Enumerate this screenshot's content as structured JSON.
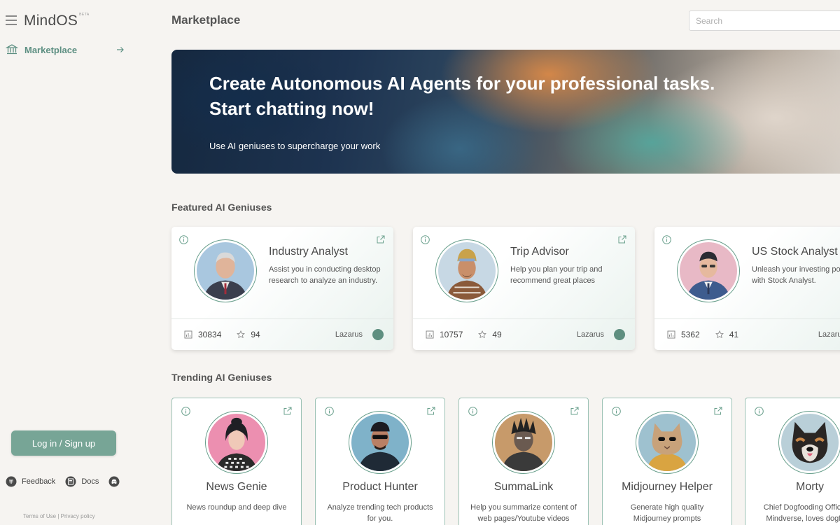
{
  "brand": {
    "name": "MindOS",
    "badge": "BETA"
  },
  "sidebar": {
    "items": [
      {
        "label": "Marketplace",
        "icon": "bank-icon"
      }
    ],
    "login_label": "Log in / Sign up",
    "footer": [
      {
        "label": "Feedback",
        "icon": "feedback-icon"
      },
      {
        "label": "Docs",
        "icon": "docs-icon"
      },
      {
        "label": "",
        "icon": "discord-icon"
      }
    ],
    "legal": {
      "terms": "Terms of Use",
      "separator": "|",
      "privacy": "Privacy policy"
    }
  },
  "header": {
    "title": "Marketplace",
    "search_placeholder": "Search"
  },
  "hero": {
    "title_line1": "Create Autonomous AI Agents for your professional tasks.",
    "title_line2": "Start chatting now!",
    "subtitle": "Use AI geniuses to supercharge your work"
  },
  "featured": {
    "title": "Featured AI Geniuses",
    "items": [
      {
        "name": "Industry Analyst",
        "desc": "Assist you in conducting desktop research to analyze an industry.",
        "uses": "30834",
        "stars": "94",
        "author": "Lazarus"
      },
      {
        "name": "Trip Advisor",
        "desc": "Help you plan your trip and recommend great places",
        "uses": "10757",
        "stars": "49",
        "author": "Lazarus"
      },
      {
        "name": "US Stock Analyst",
        "desc": "Unleash your investing potential with Stock Analyst.",
        "uses": "5362",
        "stars": "41",
        "author": "Lazarus"
      }
    ]
  },
  "trending": {
    "title": "Trending AI Geniuses",
    "items": [
      {
        "name": "News Genie",
        "desc": "News roundup and deep dive"
      },
      {
        "name": "Product Hunter",
        "desc": "Analyze trending tech products for you."
      },
      {
        "name": "SummaLink",
        "desc": "Help you summarize content of web pages/Youtube videos"
      },
      {
        "name": "Midjourney Helper",
        "desc": "Generate high quality Midjourney prompts"
      },
      {
        "name": "Morty",
        "desc": "Chief Dogfooding Officer at Mindverse, loves dogfood"
      }
    ]
  },
  "colors": {
    "accent": "#5d8f82",
    "button": "#77a596",
    "background": "#f6f4f1",
    "border": "#9cc2b5"
  }
}
